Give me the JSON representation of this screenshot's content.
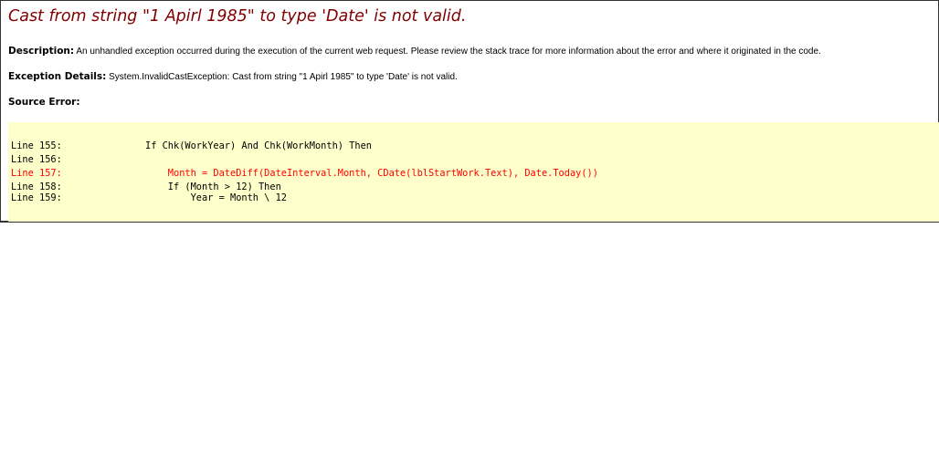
{
  "error_title": "Cast from string \"1 Apirl 1985\" to type 'Date' is not valid.",
  "description": {
    "label": "Description:",
    "text": "An unhandled exception occurred during the execution of the current web request. Please review the stack trace for more information about the error and where it originated in the code."
  },
  "exception": {
    "label": "Exception Details:",
    "text": "System.InvalidCastException: Cast from string \"1 Apirl 1985\" to type 'Date' is not valid."
  },
  "source_error": {
    "label": "Source Error:"
  },
  "code": {
    "background": "#ffffcc",
    "error_color": "#ff0000",
    "lines": [
      {
        "number": "Line 155:",
        "text": "If Chk(WorkYear) And Chk(WorkMonth) Then"
      },
      {
        "number": "Line 156:",
        "text": ""
      },
      {
        "number": "Line 157:",
        "text": "    Month = DateDiff(DateInterval.Month, CDate(lblStartWork.Text), Date.Today())"
      },
      {
        "number": "Line 158:",
        "text": "    If (Month > 12) Then"
      },
      {
        "number": "Line 159:",
        "text": "        Year = Month \\ 12"
      }
    ]
  }
}
